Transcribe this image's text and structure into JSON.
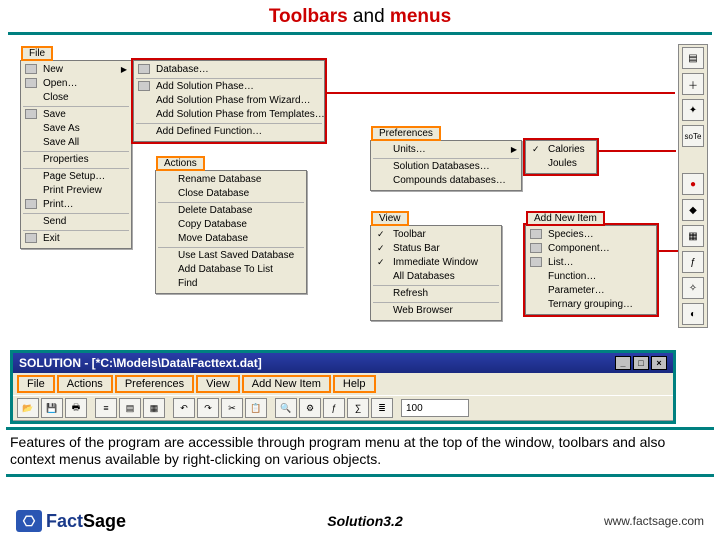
{
  "title": {
    "part1": "Toolbars",
    "part2": " and ",
    "part3": "menus"
  },
  "file_menu": {
    "label": "File",
    "items": [
      "New",
      "Open…",
      "Close",
      "Save",
      "Save As",
      "Save All",
      "Properties",
      "Page Setup…",
      "Print Preview",
      "Print…",
      "Send",
      "Exit"
    ]
  },
  "file_new_submenu": {
    "items": [
      "Database…",
      "Add Solution Phase…",
      "Add Solution Phase from Wizard…",
      "Add Solution Phase from Templates…",
      "Add Defined Function…"
    ]
  },
  "actions_menu": {
    "label": "Actions",
    "items": [
      "Rename Database",
      "Close Database",
      "Delete Database",
      "Copy Database",
      "Move Database",
      "Use Last Saved Database",
      "Add Database To List",
      "Find"
    ]
  },
  "preferences_menu": {
    "label": "Preferences",
    "items": [
      "Units…",
      "Solution Databases…",
      "Compounds databases…"
    ]
  },
  "units_submenu": {
    "items": [
      "Calories",
      "Joules"
    ]
  },
  "view_menu": {
    "label": "View",
    "items": [
      "Toolbar",
      "Status Bar",
      "Immediate Window",
      "All Databases",
      "Refresh",
      "Web Browser"
    ]
  },
  "addnew_menu": {
    "label": "Add New Item",
    "items": [
      "Species…",
      "Component…",
      "List…",
      "Function…",
      "Parameter…",
      "Ternary grouping…"
    ]
  },
  "appwin": {
    "title": "SOLUTION - [*C:\\Models\\Data\\Facttext.dat]",
    "menus": [
      "File",
      "Actions",
      "Preferences",
      "View",
      "Add New Item",
      "Help"
    ],
    "zoom": "100"
  },
  "description": "Features of the program are accessible through program menu at the top of the window, toolbars and also context menus available by right-clicking on various objects.",
  "footer": {
    "logo_fact": "Fact",
    "logo_sage": "Sage",
    "slide": "Solution",
    "version": "3.2",
    "url": "www.factsage.com"
  }
}
